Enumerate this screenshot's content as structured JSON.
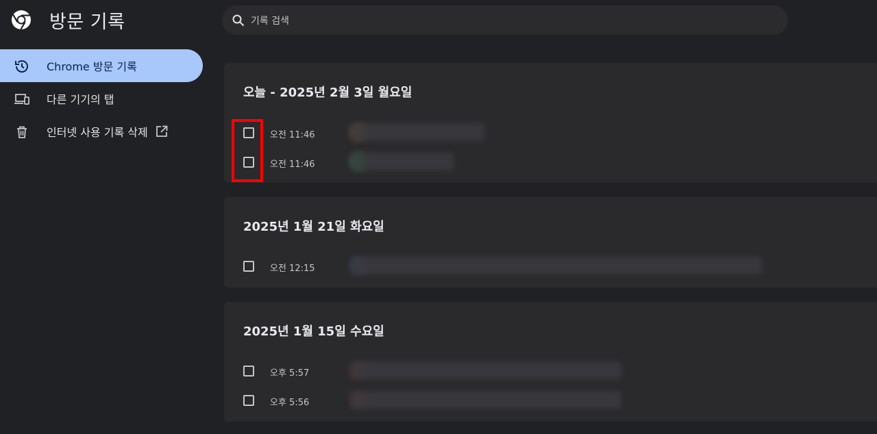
{
  "header": {
    "title": "방문 기록",
    "logo_icon": "chrome-logo",
    "search_placeholder": "기록 검색"
  },
  "sidebar": {
    "items": [
      {
        "label": "Chrome 방문 기록",
        "icon": "history-icon",
        "active": true
      },
      {
        "label": "다른 기기의 탭",
        "icon": "devices-icon",
        "active": false
      },
      {
        "label": "인터넷 사용 기록 삭제",
        "icon": "trash-icon",
        "active": false
      }
    ]
  },
  "groups": [
    {
      "title": "오늘 - 2025년 2월 3일 월요일",
      "entries": [
        {
          "time": "오전 11:46"
        },
        {
          "time": "오전 11:46"
        }
      ]
    },
    {
      "title": "2025년 1월 21일 화요일",
      "entries": [
        {
          "time": "오전 12:15"
        }
      ]
    },
    {
      "title": "2025년 1월 15일 수요일",
      "entries": [
        {
          "time": "오후 5:57"
        },
        {
          "time": "오후 5:56"
        }
      ]
    }
  ],
  "colors": {
    "background": "#202124",
    "card": "#2a2a2d",
    "active_nav": "#a8c7fa",
    "highlight": "#ff0000"
  }
}
